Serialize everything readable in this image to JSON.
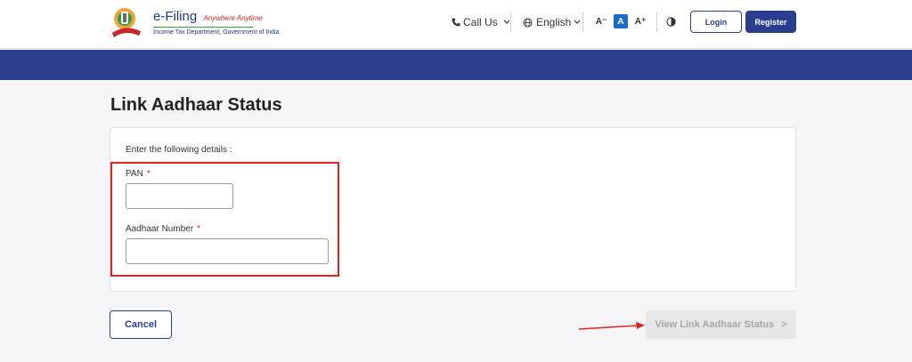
{
  "header": {
    "logo": {
      "title": "e-Filing",
      "tagline": "Anywhere Anytime",
      "subtitle": "Income Tax Department, Government of India"
    },
    "call_us": "Call Us",
    "language": "English",
    "font_decrease": "A⁻",
    "font_default": "A",
    "font_increase": "A⁺",
    "login": "Login",
    "register": "Register"
  },
  "page": {
    "title": "Link Aadhaar Status",
    "intro": "Enter the following details :",
    "fields": [
      {
        "label": "PAN",
        "required_mark": "*",
        "value": "",
        "placeholder": ""
      },
      {
        "label": "Aadhaar Number",
        "required_mark": "*",
        "value": "",
        "placeholder": ""
      }
    ]
  },
  "actions": {
    "cancel": "Cancel",
    "view_status": "View Link Aadhaar Status",
    "view_status_chevron": ">"
  },
  "colors": {
    "brand_blue": "#2c3e8e",
    "annotation_red": "#e2241f",
    "disabled_bg": "#e7e7e7"
  },
  "icons": [
    "emblem-icon",
    "phone-icon",
    "chevron-down-icon",
    "globe-icon",
    "contrast-icon",
    "annotation-arrow"
  ]
}
